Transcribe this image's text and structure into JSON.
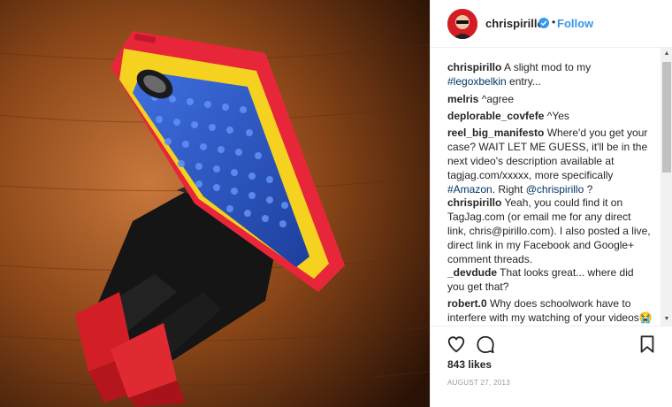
{
  "post": {
    "username": "chrispirillo",
    "follow_label": "Follow",
    "dot": "•",
    "likes": "843 likes",
    "date": "AUGUST 27, 2013"
  },
  "comments": [
    {
      "user": "chrispirillo",
      "text": " A slight mod to my ",
      "link1": "#legoxbelkin",
      "text2": " entry..."
    },
    {
      "user": "melris",
      "text": " ^agree"
    },
    {
      "user": "deplorable_covfefe",
      "text": " ^Yes"
    },
    {
      "user": "reel_big_manifesto",
      "text": " Where'd you get your case? WAIT LET ME GUESS, it'll be in the next video's description available at tagjag.com/xxxxx, more specifically ",
      "link1": "#Amazon",
      "text2": ". Right ",
      "link2": "@chrispirillo",
      "text3": " ?"
    },
    {
      "user": "chrispirillo",
      "text": " Yeah, you could find it on TagJag.com (or email me for any direct link, chris@pirillo.com). I also posted a live, direct link in my Facebook and Google+ comment threads."
    },
    {
      "user": "_devdude",
      "text": " That looks great... where did you get that?"
    },
    {
      "user": "robert.0",
      "text": " Why does schoolwork have to interfere with my watching of your videos😭"
    }
  ],
  "icons": {
    "heart": "heart-icon",
    "comment": "comment-icon",
    "bookmark": "bookmark-icon",
    "verified": "verified-badge-icon"
  },
  "colors": {
    "accent": "#3897f0",
    "link": "#003569",
    "case_red": "#e8263a",
    "case_yellow": "#f4d21f",
    "lego_blue": "#2a57c8"
  }
}
